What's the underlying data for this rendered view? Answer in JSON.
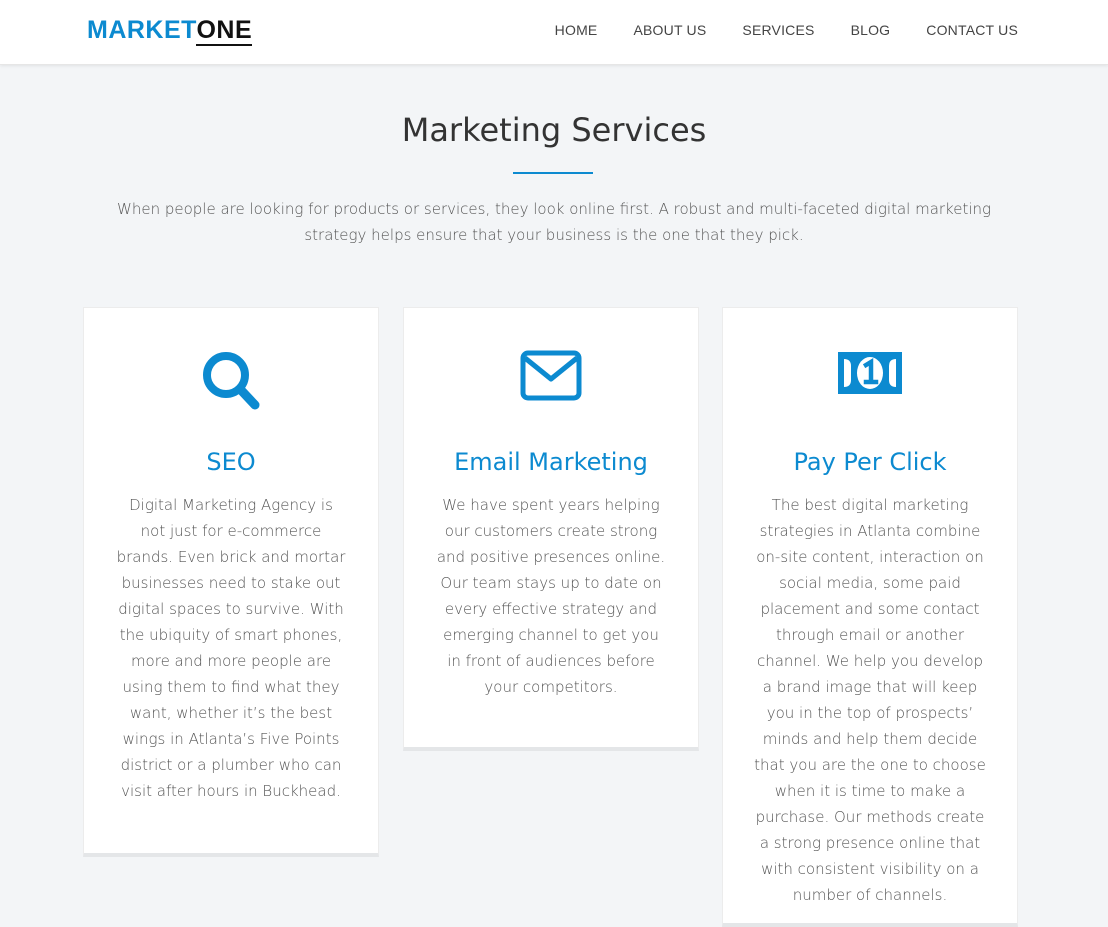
{
  "header": {
    "logo_part1": "MARKET",
    "logo_part2": "ONE",
    "nav": [
      "HOME",
      "ABOUT US",
      "SERVICES",
      "BLOG",
      "CONTACT US"
    ]
  },
  "section": {
    "title": "Marketing Services",
    "intro": "When people are looking for products or services, they look online first. A robust and multi-faceted digital marketing strategy helps ensure that your business is the one that they pick."
  },
  "cards": [
    {
      "icon": "search-icon",
      "title": "SEO",
      "text": "Digital Marketing Agency is not just for e-commerce brands. Even brick and mortar businesses need to stake out digital spaces to survive. With the ubiquity of smart phones, more and more people are using them to find what they want, whether it’s the best wings in Atlanta’s Five Points district or a plumber who can visit after hours in Buckhead."
    },
    {
      "icon": "envelope-icon",
      "title": "Email Marketing",
      "text": "We have spent years helping our customers create strong and positive presences online. Our team stays up to date on every effective strategy and emerging channel to get you in front of audiences before your competitors."
    },
    {
      "icon": "money-bill-icon",
      "title": "Pay Per Click",
      "text": "The best digital marketing strategies in Atlanta combine on-site content, interaction on social media, some paid placement and some contact through email or another channel. We help you develop a brand image that will keep you in the top of prospects’ minds and help them decide that you are the one to choose when it is time to make a purchase. Our methods create a strong presence online that with consistent visibility on a number of channels."
    }
  ],
  "colors": {
    "accent": "#0c8ad0",
    "background": "#f3f5f7"
  }
}
